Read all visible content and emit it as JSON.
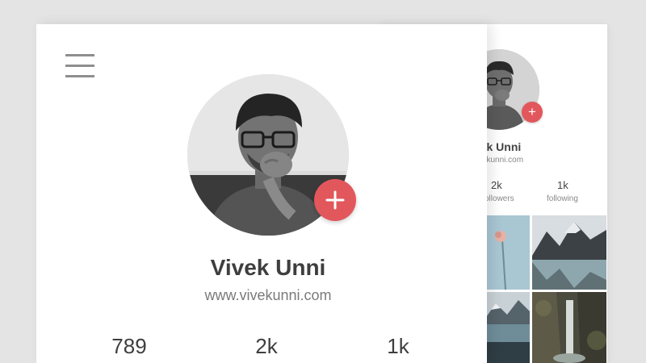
{
  "profile": {
    "name": "Vivek Unni",
    "website": "www.vivekunni.com",
    "add_icon": "plus-icon"
  },
  "stats": [
    {
      "value": "789"
    },
    {
      "value": "2k"
    },
    {
      "value": "1k"
    }
  ],
  "back_card": {
    "name": "ek Unni",
    "website": "vekunni.com",
    "stats": [
      {
        "value": "2k",
        "label": "ollowers"
      },
      {
        "value": "1k",
        "label": "following"
      }
    ]
  },
  "colors": {
    "accent": "#e2575c",
    "text_dark": "#3e3e3e",
    "text_muted": "#7a7a7a",
    "background": "#e4e4e4"
  }
}
